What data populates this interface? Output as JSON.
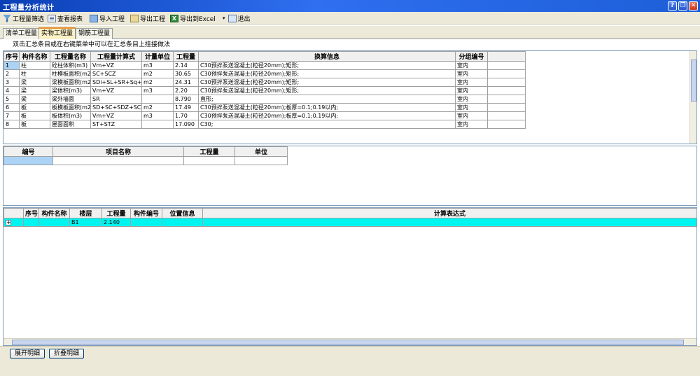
{
  "window": {
    "title": "工程量分析统计"
  },
  "toolbar": {
    "filter": "工程量筛选",
    "report": "查看报表",
    "import": "导入工程",
    "export": "导出工程",
    "excel": "导出到Excel",
    "exit": "退出"
  },
  "tabs": [
    "清单工程量",
    "实物工程量",
    "钢筋工程量"
  ],
  "hint": "双击汇总条目或在右键菜单中可以在汇总条目上挂接做法",
  "grid1": {
    "headers": [
      "序号",
      "构件名称",
      "工程量名称",
      "工程量计算式",
      "计量单位",
      "工程量",
      "换算信息",
      "分组编号"
    ],
    "rows": [
      [
        "1",
        "柱",
        "砼柱体积(m3)",
        "Vm+VZ",
        "m3",
        "2.14",
        "C30预拌泵送混凝土(粒径20mm);矩形;",
        "室内"
      ],
      [
        "2",
        "柱",
        "柱模板面积(m2)",
        "SC+SCZ",
        "m2",
        "30.65",
        "C30预拌泵送混凝土(粒径20mm);矩形;",
        "室内"
      ],
      [
        "3",
        "梁",
        "梁模板面积(m2)",
        "SDi+SL+SR+Sq+Sz+SCZ",
        "m2",
        "24.31",
        "C30预拌泵送混凝土(粒径20mm);矩形;",
        "室内"
      ],
      [
        "4",
        "梁",
        "梁体积(m3)",
        "Vm+VZ",
        "m3",
        "2.20",
        "C30预拌泵送混凝土(粒径20mm);矩形;",
        "室内"
      ],
      [
        "5",
        "梁",
        "梁外墙面",
        "SR",
        "",
        "8.790",
        "直形;",
        "室内"
      ],
      [
        "6",
        "板",
        "板模板面积(m2)",
        "SD+SC+SDZ+SCZ",
        "m2",
        "17.49",
        "C30预拌泵送混凝土(粒径20mm);板厚=0.1;0.19以内;",
        "室内"
      ],
      [
        "7",
        "板",
        "板体积(m3)",
        "Vm+VZ",
        "m3",
        "1.70",
        "C30预拌泵送混凝土(粒径20mm);板厚=0.1;0.19以内;",
        "室内"
      ],
      [
        "8",
        "板",
        "屋面面积",
        "ST+STZ",
        "",
        "17.090",
        "C30;",
        "室内"
      ]
    ]
  },
  "grid2": {
    "headers": [
      "编号",
      "项目名称",
      "工程量",
      "单位"
    ]
  },
  "grid3": {
    "headers": [
      "序号",
      "构件名称",
      "楼层",
      "工程量",
      "构件编号",
      "位置信息",
      "计算表达式"
    ],
    "rows": [
      [
        "",
        "",
        "B1",
        "2.140",
        "",
        "",
        ""
      ]
    ]
  },
  "buttons": {
    "expand": "展开明细",
    "collapse": "折叠明细"
  }
}
